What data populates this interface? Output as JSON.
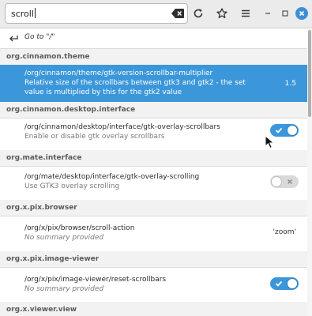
{
  "search": {
    "value": "scroll"
  },
  "goto": {
    "label": "Go to \"/\""
  },
  "sections": [
    {
      "header": "org.cinnamon.theme",
      "keys": [
        {
          "path": "/org/cinnamon/theme/gtk-version-scrollbar-multiplier",
          "summary_line1": "Relative size of the scrollbars between gtk3 and gtk2 - the set",
          "summary_line2": "value is multiplied by this for the gtk2 value",
          "value": "1.5",
          "selected": true
        }
      ]
    },
    {
      "header": "org.cinnamon.desktop.interface",
      "keys": [
        {
          "path": "/org/cinnamon/desktop/interface/gtk-overlay-scrollbars",
          "summary": "Enable or disable gtk overlay scrollbars",
          "toggle": true
        }
      ]
    },
    {
      "header": "org.mate.interface",
      "keys": [
        {
          "path": "/org/mate/desktop/interface/gtk-overlay-scrolling",
          "summary": "Use GTK3 overlay scrolling",
          "toggle": false
        }
      ]
    },
    {
      "header": "org.x.pix.browser",
      "keys": [
        {
          "path": "/org/x/pix/browser/scroll-action",
          "summary": "No summary provided",
          "value": "'zoom'"
        }
      ]
    },
    {
      "header": "org.x.pix.image-viewer",
      "keys": [
        {
          "path": "/org/x/pix/image-viewer/reset-scrollbars",
          "summary": "No summary provided",
          "toggle": true
        }
      ]
    },
    {
      "header": "org.x.viewer.view",
      "keys": []
    }
  ],
  "colors": {
    "accent": "#3c97da",
    "section_bg": "#f2f2f2",
    "header_bg": "#ebebeb"
  },
  "icons": {
    "clear": "clear-search-icon",
    "refresh": "reload-icon",
    "bookmark": "star-icon",
    "menu": "hamburger-menu-icon",
    "minimize": "minimize-icon",
    "maximize": "maximize-icon",
    "close": "close-icon",
    "goto": "back-arrow-icon"
  }
}
